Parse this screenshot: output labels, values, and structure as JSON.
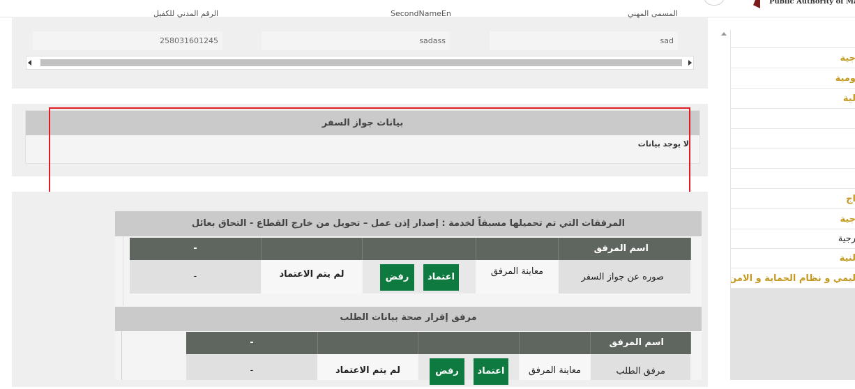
{
  "header": {
    "authority_text": "Public Authority of Manpo"
  },
  "prev_section": {
    "labels": [
      "الرقم المدني للكفيل",
      "SecondNameEn",
      "المسمى المهني"
    ],
    "values": [
      "258031601245",
      "sadass",
      "sad"
    ]
  },
  "passport_section": {
    "title": "بيانات جواز السفر",
    "no_data": "لا يوجد بيانات"
  },
  "attachments": {
    "title": "المرفقات التي تم تحميلها مسبقاً لخدمة : إصدار إذن عمل – تحويل من خارج القطاع - التحاق بعائل",
    "header_name": "اسم المرفق",
    "header_dash": "-",
    "row": {
      "name": "صوره عن جواز السفر",
      "preview": "معاينة المرفق",
      "approve": "اعتماد",
      "reject": "رفض",
      "status": "لم يتم الاعتماد",
      "dash": "-"
    }
  },
  "declaration": {
    "title": "مرفق إقرار صحة بيانات الطلب",
    "header_name": "اسم المرفق",
    "header_dash": "-",
    "row": {
      "name": "مرفق الطلب",
      "preview": "معاينة المرفق",
      "approve": "اعتماد",
      "reject": "رفض",
      "status": "لم يتم الاعتماد",
      "dash": "-"
    }
  },
  "sidebar": {
    "items": [
      {
        "label": ""
      },
      {
        "label": "جية"
      },
      {
        "label": "ومية"
      },
      {
        "label": "لية"
      },
      {
        "label": ""
      },
      {
        "label": ""
      },
      {
        "label": ""
      },
      {
        "label": ""
      },
      {
        "label": "اج"
      },
      {
        "label": "جية"
      },
      {
        "label": "رجية"
      },
      {
        "label": "لنية"
      },
      {
        "label": "ليمي و نظام الحماية و الامن"
      }
    ]
  },
  "colors": {
    "accent_gold": "#c49a22",
    "approve_green": "#0f7a40",
    "table_header": "#5f655f",
    "highlight_red": "#e01b22"
  }
}
